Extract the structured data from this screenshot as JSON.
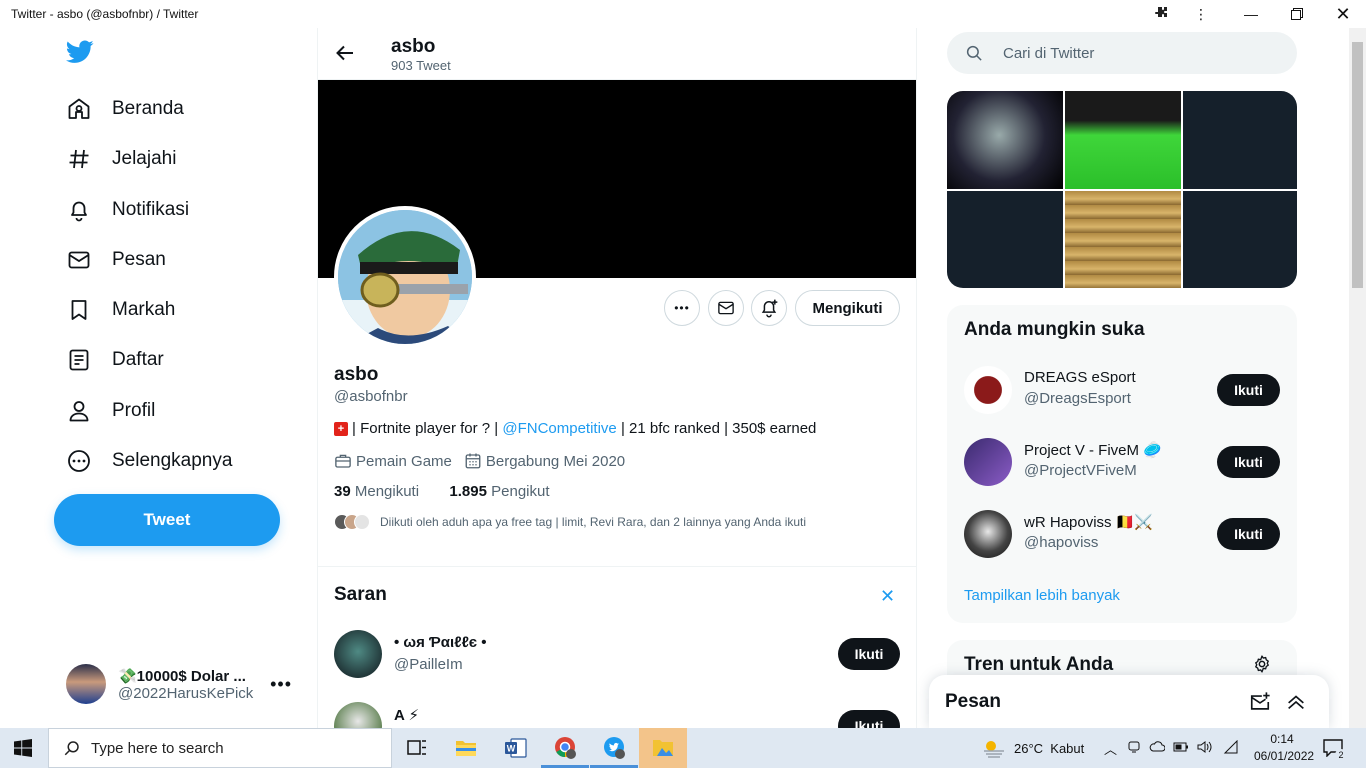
{
  "window": {
    "title": "Twitter - asbo (@asbofnbr) / Twitter"
  },
  "nav": {
    "items": [
      {
        "label": "Beranda",
        "icon": "home-icon"
      },
      {
        "label": "Jelajahi",
        "icon": "hashtag-icon"
      },
      {
        "label": "Notifikasi",
        "icon": "bell-icon"
      },
      {
        "label": "Pesan",
        "icon": "mail-icon"
      },
      {
        "label": "Markah",
        "icon": "bookmark-icon"
      },
      {
        "label": "Daftar",
        "icon": "list-icon"
      },
      {
        "label": "Profil",
        "icon": "person-icon"
      },
      {
        "label": "Selengkapnya",
        "icon": "more-circle-icon"
      }
    ],
    "tweet_button": "Tweet"
  },
  "account": {
    "name": "💸10000$ Dolar ...",
    "handle": "@2022HarusKePick"
  },
  "header": {
    "name": "asbo",
    "tweet_count": "903 Tweet"
  },
  "profile": {
    "display_name": "asbo",
    "username": "@asbofnbr",
    "bio_prefix": "| Fortnite player for ? | ",
    "bio_link": "@FNCompetitive",
    "bio_suffix": " | 21 bfc ranked | 350$ earned",
    "category": "Pemain Game",
    "joined": "Bergabung Mei 2020",
    "following_count": "39",
    "following_label": "Mengikuti",
    "followers_count": "1.895",
    "followers_label": "Pengikut",
    "followed_by": "Diikuti oleh aduh apa ya free tag | limit, Revi Rara, dan 2 lainnya yang Anda ikuti",
    "following_button": "Mengikuti"
  },
  "suggestions": {
    "title": "Saran",
    "items": [
      {
        "name": "• ωя Ƥαιℓℓє •",
        "handle": "@PailleIm",
        "button": "Ikuti"
      },
      {
        "name": "A ⚡",
        "handle": "",
        "button": "Ikuti"
      }
    ]
  },
  "search": {
    "placeholder": "Cari di Twitter"
  },
  "who_to_follow": {
    "title": "Anda mungkin suka",
    "items": [
      {
        "name": "DREAGS eSport",
        "handle": "@DreagsEsport",
        "button": "Ikuti"
      },
      {
        "name": "Project V - FiveM 🥏",
        "handle": "@ProjectVFiveM",
        "button": "Ikuti"
      },
      {
        "name": "wR Hapoviss 🇧🇪⚔️",
        "handle": "@hapoviss",
        "button": "Ikuti"
      }
    ],
    "show_more": "Tampilkan lebih banyak"
  },
  "trends": {
    "title": "Tren untuk Anda"
  },
  "messages_dock": {
    "title": "Pesan"
  },
  "taskbar": {
    "search_placeholder": "Type here to search",
    "weather": "26°C  Kabut",
    "time": "0:14",
    "date": "06/01/2022",
    "notification_count": "2"
  },
  "colors": {
    "accent": "#1d9bf0",
    "text": "#0f1419",
    "secondary_text": "#536471",
    "dark_button": "#0f1419"
  }
}
